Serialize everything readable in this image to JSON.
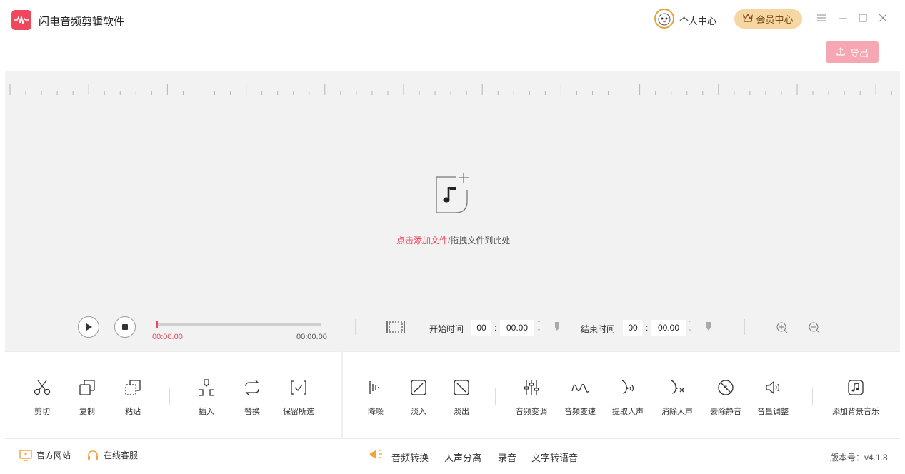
{
  "app": {
    "title": "闪电音频剪辑软件",
    "brand_color": "#f0475d",
    "profile_label": "个人中心",
    "vip_label": "会员中心"
  },
  "toolbar": {
    "export_label": "导出"
  },
  "drop": {
    "link_text": "点击添加文件",
    "rest_text": "/拖拽文件到此处"
  },
  "player": {
    "current_time": "00:00.00",
    "total_time": "00:00.00",
    "progress": 0,
    "start_label": "开始时间",
    "start_min": "00",
    "start_sec": "00.00",
    "end_label": "结束时间",
    "end_min": "00",
    "end_sec": "00.00"
  },
  "tools": {
    "cut": "剪切",
    "copy": "复制",
    "paste": "粘贴",
    "insert": "插入",
    "replace": "替换",
    "keep_selection": "保留所选",
    "denoise": "降噪",
    "fade_in": "淡入",
    "fade_out": "淡出",
    "pitch": "音频变调",
    "speed": "音频变速",
    "extract_voice": "提取人声",
    "remove_voice": "消除人声",
    "remove_silence": "去除静音",
    "volume": "音量调整",
    "add_bgm": "添加背景音乐"
  },
  "footer": {
    "website": "官方网站",
    "support": "在线客服",
    "convert": "音频转换",
    "separate": "人声分离",
    "record": "录音",
    "tts": "文字转语音",
    "version": "版本号：v4.1.8"
  }
}
